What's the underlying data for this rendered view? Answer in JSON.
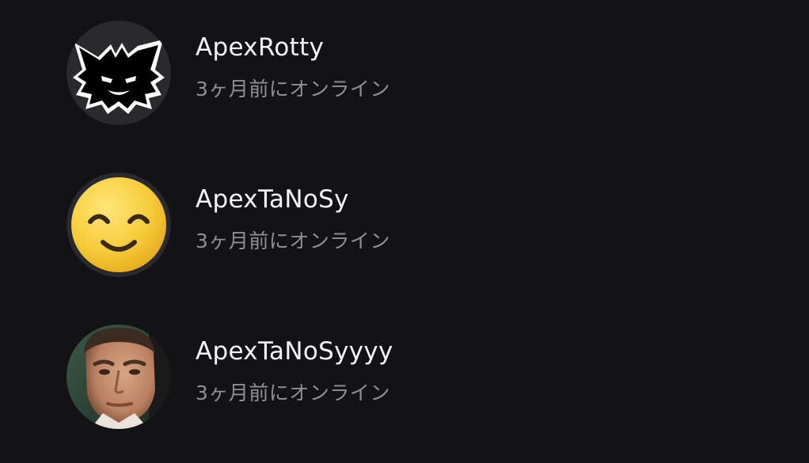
{
  "contacts": [
    {
      "username": "ApexRotty",
      "status": "3ヶ月前にオンライン",
      "avatar_icon": "black-cat-icon"
    },
    {
      "username": "ApexTaNoSy",
      "status": "3ヶ月前にオンライン",
      "avatar_icon": "smiling-face-icon"
    },
    {
      "username": "ApexTaNoSyyyy",
      "status": "3ヶ月前にオンライン",
      "avatar_icon": "man-portrait-icon"
    }
  ],
  "colors": {
    "background": "#131315",
    "username_text": "#f4f4f6",
    "status_text": "#8f8f96",
    "emoji_yellow": "#f7cc3a"
  }
}
